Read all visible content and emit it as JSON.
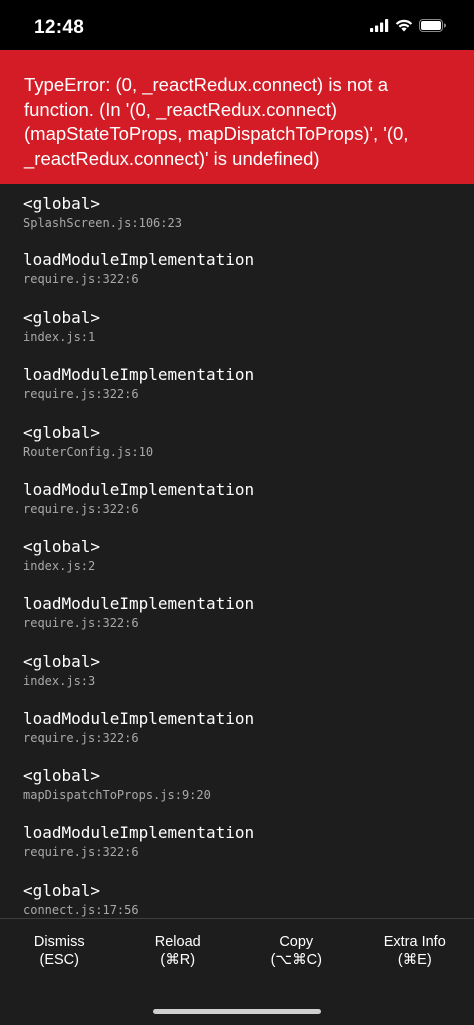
{
  "status_bar": {
    "time": "12:48",
    "icons": [
      "signal-icon",
      "wifi-icon",
      "battery-icon"
    ]
  },
  "error": {
    "message": "TypeError: (0, _reactRedux.connect) is not a function. (In '(0, _reactRedux.connect)(mapStateToProps, mapDispatchToProps)', '(0, _reactRedux.connect)' is undefined)",
    "lines": [
      "TypeError: (0, _reactRedux.connect) is not a",
      "function. (In '(0, _reactRedux.connect)",
      "(mapStateToProps, mapDispatchToProps)', '(0,",
      "_reactRedux.connect)' is undefined)"
    ],
    "background_color": "#d31c26"
  },
  "stack": [
    {
      "method": "<global>",
      "file": "SplashScreen.js:106:23"
    },
    {
      "method": "loadModuleImplementation",
      "file": "require.js:322:6"
    },
    {
      "method": "<global>",
      "file": "index.js:1"
    },
    {
      "method": "loadModuleImplementation",
      "file": "require.js:322:6"
    },
    {
      "method": "<global>",
      "file": "RouterConfig.js:10"
    },
    {
      "method": "loadModuleImplementation",
      "file": "require.js:322:6"
    },
    {
      "method": "<global>",
      "file": "index.js:2"
    },
    {
      "method": "loadModuleImplementation",
      "file": "require.js:322:6"
    },
    {
      "method": "<global>",
      "file": "index.js:3"
    },
    {
      "method": "loadModuleImplementation",
      "file": "require.js:322:6"
    },
    {
      "method": "<global>",
      "file": "mapDispatchToProps.js:9:20"
    },
    {
      "method": "loadModuleImplementation",
      "file": "require.js:322:6"
    },
    {
      "method": "<global>",
      "file": "connect.js:17:56"
    }
  ],
  "footer": {
    "buttons": [
      {
        "label": "Dismiss",
        "shortcut": "(ESC)"
      },
      {
        "label": "Reload",
        "shortcut": "(⌘R)"
      },
      {
        "label": "Copy",
        "shortcut": "(⌥⌘C)"
      },
      {
        "label": "Extra Info",
        "shortcut": "(⌘E)"
      }
    ]
  }
}
